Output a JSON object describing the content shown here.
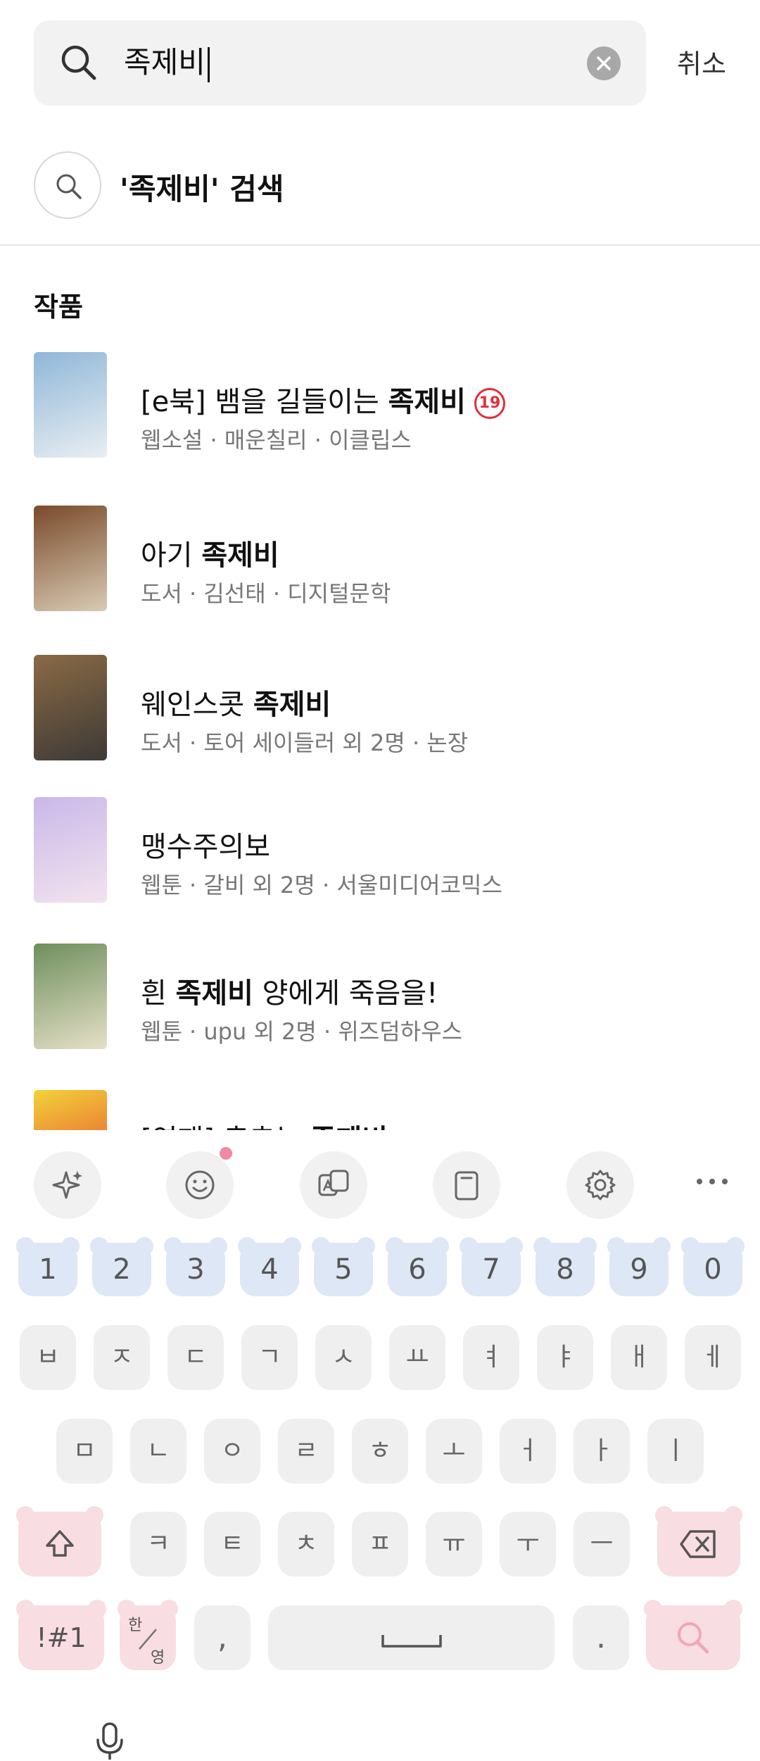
{
  "search": {
    "query": "족제비",
    "cancel_label": "취소"
  },
  "suggestion": {
    "label": "'족제비' 검색"
  },
  "results_section": {
    "title": "작품",
    "items": [
      {
        "title_prefix": "[e북] 뱀을 길들이는 ",
        "title_bold": "족제비",
        "title_suffix": "",
        "meta": "웹소설 · 매운칠리 · 이클립스",
        "badge": "19",
        "cover_colors": [
          "#8fb7d8",
          "#e9eef2"
        ]
      },
      {
        "title_prefix": "아기 ",
        "title_bold": "족제비",
        "title_suffix": "",
        "meta": "도서 · 김선태 · 디지털문학",
        "badge": "",
        "cover_colors": [
          "#7a4a2a",
          "#d8cbb4"
        ]
      },
      {
        "title_prefix": "웨인스콧 ",
        "title_bold": "족제비",
        "title_suffix": "",
        "meta": "도서 · 토어 세이들러 외 2명 · 논장",
        "badge": "",
        "cover_colors": [
          "#8a6a45",
          "#3e3a36"
        ]
      },
      {
        "title_prefix": "맹수주의보",
        "title_bold": "",
        "title_suffix": "",
        "meta": "웹툰 · 갈비 외 2명 · 서울미디어코믹스",
        "badge": "",
        "cover_colors": [
          "#c9b8e8",
          "#f3e3ef"
        ]
      },
      {
        "title_prefix": "흰 ",
        "title_bold": "족제비",
        "title_suffix": " 양에게 죽음을!",
        "meta": "웹툰 · upu 외 2명 · 위즈덤하우스",
        "badge": "",
        "cover_colors": [
          "#6e8f5c",
          "#e6e0c8"
        ]
      },
      {
        "title_prefix": "[연재] 춤추는 ",
        "title_bold": "족제비",
        "title_suffix": "",
        "meta": "",
        "badge": "",
        "cover_colors": [
          "#f2d23a",
          "#e63b2e"
        ]
      }
    ]
  },
  "keyboard": {
    "number_row": [
      "1",
      "2",
      "3",
      "4",
      "5",
      "6",
      "7",
      "8",
      "9",
      "0"
    ],
    "row1": [
      "ㅂ",
      "ㅈ",
      "ㄷ",
      "ㄱ",
      "ㅅ",
      "ㅛ",
      "ㅕ",
      "ㅑ",
      "ㅐ",
      "ㅔ"
    ],
    "row2": [
      "ㅁ",
      "ㄴ",
      "ㅇ",
      "ㄹ",
      "ㅎ",
      "ㅗ",
      "ㅓ",
      "ㅏ",
      "ㅣ"
    ],
    "row3": [
      "ㅋ",
      "ㅌ",
      "ㅊ",
      "ㅍ",
      "ㅠ",
      "ㅜ",
      "ㅡ"
    ],
    "symbols_label": "!#1",
    "lang_top": "한",
    "lang_bottom": "영",
    "comma": ",",
    "period": "."
  }
}
